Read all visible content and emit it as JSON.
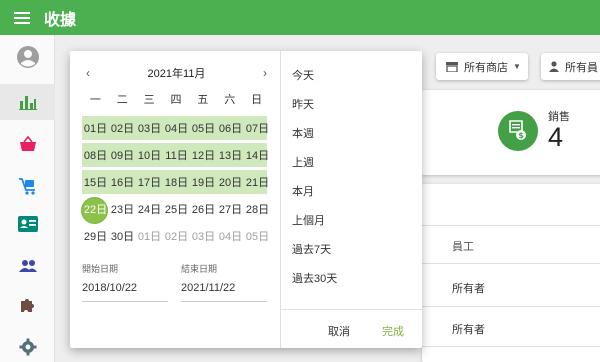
{
  "app": {
    "title": "收據"
  },
  "sidebar": {
    "items": [
      {
        "icon": "account-circle-icon",
        "color": "#9e9e9e"
      },
      {
        "icon": "bar-chart-icon",
        "color": "#43a047",
        "active": true
      },
      {
        "icon": "basket-icon",
        "color": "#e91e63"
      },
      {
        "icon": "cart-icon",
        "color": "#1e88e5"
      },
      {
        "icon": "id-card-icon",
        "color": "#00897b"
      },
      {
        "icon": "people-icon",
        "color": "#3949ab"
      },
      {
        "icon": "puzzle-icon",
        "color": "#6d4c41"
      },
      {
        "icon": "gear-icon",
        "color": "#546e7a"
      }
    ]
  },
  "filters": {
    "store": "所有商店",
    "employee": "所有員"
  },
  "summary": {
    "sales_label": "銷售",
    "sales_value": "4"
  },
  "table": {
    "employee_header": "員工",
    "rows": [
      "所有者",
      "所有者"
    ]
  },
  "datepicker": {
    "month_label": "2021年11月",
    "prev_icon": "chevron-left-icon",
    "next_icon": "chevron-right-icon",
    "weekdays": [
      "一",
      "二",
      "三",
      "四",
      "五",
      "六",
      "日"
    ],
    "days": [
      {
        "label": "01日",
        "range": true
      },
      {
        "label": "02日",
        "range": true
      },
      {
        "label": "03日",
        "range": true
      },
      {
        "label": "04日",
        "range": true
      },
      {
        "label": "05日",
        "range": true
      },
      {
        "label": "06日",
        "range": true
      },
      {
        "label": "07日",
        "range": true
      },
      {
        "label": "08日",
        "range": true
      },
      {
        "label": "09日",
        "range": true
      },
      {
        "label": "10日",
        "range": true
      },
      {
        "label": "11日",
        "range": true
      },
      {
        "label": "12日",
        "range": true
      },
      {
        "label": "13日",
        "range": true
      },
      {
        "label": "14日",
        "range": true
      },
      {
        "label": "15日",
        "range": true
      },
      {
        "label": "16日",
        "range": true
      },
      {
        "label": "17日",
        "range": true
      },
      {
        "label": "18日",
        "range": true
      },
      {
        "label": "19日",
        "range": true
      },
      {
        "label": "20日",
        "range": true
      },
      {
        "label": "21日",
        "range": true
      },
      {
        "label": "22日",
        "selected": true
      },
      {
        "label": "23日"
      },
      {
        "label": "24日"
      },
      {
        "label": "25日"
      },
      {
        "label": "26日"
      },
      {
        "label": "27日"
      },
      {
        "label": "28日"
      },
      {
        "label": "29日"
      },
      {
        "label": "30日"
      },
      {
        "label": "01日",
        "other": true
      },
      {
        "label": "02日",
        "other": true
      },
      {
        "label": "03日",
        "other": true
      },
      {
        "label": "04日",
        "other": true
      },
      {
        "label": "05日",
        "other": true
      }
    ],
    "start_label": "開始日期",
    "start_value": "2018/10/22",
    "end_label": "結束日期",
    "end_value": "2021/11/22",
    "presets": [
      "今天",
      "昨天",
      "本週",
      "上週",
      "本月",
      "上個月",
      "過去7天",
      "過去30天"
    ],
    "cancel_label": "取消",
    "done_label": "完成",
    "accent_color": "#8bc34a",
    "range_color": "#cfe8bc"
  }
}
